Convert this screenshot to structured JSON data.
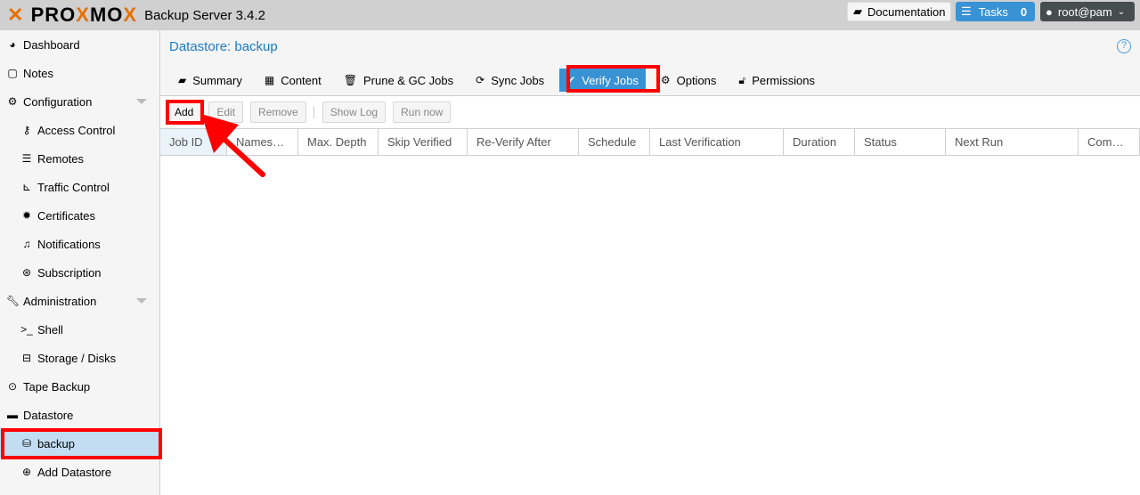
{
  "header": {
    "logo": "PROXMOX",
    "product": "Backup Server 3.4.2",
    "documentation": "Documentation",
    "tasks": "Tasks",
    "tasks_count": "0",
    "user": "root@pam"
  },
  "sidebar": {
    "items": [
      {
        "label": "Dashboard",
        "icon": "dashboard-icon"
      },
      {
        "label": "Notes",
        "icon": "notes-icon"
      },
      {
        "label": "Configuration",
        "icon": "gears-icon"
      },
      {
        "label": "Access Control",
        "icon": "key-icon"
      },
      {
        "label": "Remotes",
        "icon": "server-icon"
      },
      {
        "label": "Traffic Control",
        "icon": "chart-icon"
      },
      {
        "label": "Certificates",
        "icon": "certificate-icon"
      },
      {
        "label": "Notifications",
        "icon": "bell-icon"
      },
      {
        "label": "Subscription",
        "icon": "support-icon"
      },
      {
        "label": "Administration",
        "icon": "wrench-icon"
      },
      {
        "label": "Shell",
        "icon": "terminal-icon"
      },
      {
        "label": "Storage / Disks",
        "icon": "hdd-icon"
      },
      {
        "label": "Tape Backup",
        "icon": "tape-icon"
      },
      {
        "label": "Datastore",
        "icon": "archive-icon"
      },
      {
        "label": "backup",
        "icon": "database-icon"
      },
      {
        "label": "Add Datastore",
        "icon": "plus-circle-icon"
      }
    ]
  },
  "main": {
    "title": "Datastore: backup",
    "tabs": [
      "Summary",
      "Content",
      "Prune & GC Jobs",
      "Sync Jobs",
      "Verify Jobs",
      "Options",
      "Permissions"
    ],
    "active_tab": "Verify Jobs",
    "toolbar": {
      "add": "Add",
      "edit": "Edit",
      "remove": "Remove",
      "show_log": "Show Log",
      "run_now": "Run now"
    },
    "columns": [
      "Job ID",
      "Names…",
      "Max. Depth",
      "Skip Verified",
      "Re-Verify After",
      "Schedule",
      "Last Verification",
      "Duration",
      "Status",
      "Next Run",
      "Com…"
    ]
  },
  "colors": {
    "accent": "#3892d4",
    "brand": "#e57000",
    "annotation": "#ff0000"
  }
}
